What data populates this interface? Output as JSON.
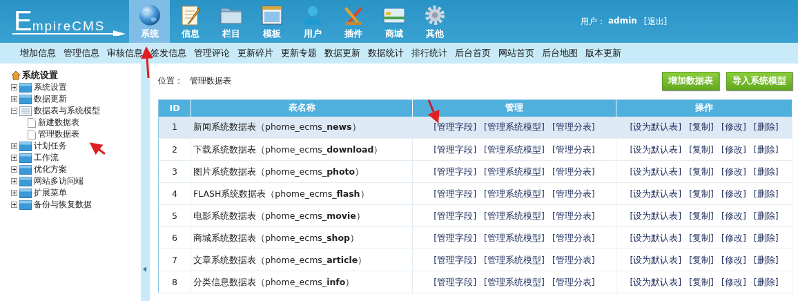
{
  "logo": {
    "text": "EmpireCMS"
  },
  "nav": [
    {
      "label": "系统",
      "kind": "globe",
      "selected": true
    },
    {
      "label": "信息",
      "kind": "notepad",
      "selected": false
    },
    {
      "label": "栏目",
      "kind": "folder",
      "selected": false
    },
    {
      "label": "模板",
      "kind": "window",
      "selected": false
    },
    {
      "label": "用户",
      "kind": "person",
      "selected": false
    },
    {
      "label": "插件",
      "kind": "tools",
      "selected": false
    },
    {
      "label": "商城",
      "kind": "card",
      "selected": false
    },
    {
      "label": "其他",
      "kind": "gear",
      "selected": false
    }
  ],
  "user": {
    "label": "用户：",
    "name": "admin",
    "logout": "[退出]"
  },
  "subnav": [
    "增加信息",
    "管理信息",
    "审核信息",
    "签发信息",
    "管理评论",
    "更新碎片",
    "更新专题",
    "数据更新",
    "数据统计",
    "排行统计",
    "后台首页",
    "网站首页",
    "后台地图",
    "版本更新"
  ],
  "sidebar": {
    "title": "系统设置",
    "items": [
      {
        "label": "系统设置",
        "expanded": false
      },
      {
        "label": "数据更新",
        "expanded": false
      },
      {
        "label": "数据表与系统模型",
        "expanded": true,
        "children": [
          {
            "label": "新建数据表"
          },
          {
            "label": "管理数据表"
          }
        ]
      },
      {
        "label": "计划任务",
        "expanded": false
      },
      {
        "label": "工作流",
        "expanded": false
      },
      {
        "label": "优化方案",
        "expanded": false
      },
      {
        "label": "网站多访问端",
        "expanded": false
      },
      {
        "label": "扩展菜单",
        "expanded": false
      },
      {
        "label": "备份与恢复数据",
        "expanded": false
      }
    ]
  },
  "location": {
    "label": "位置：",
    "value": "管理数据表"
  },
  "buttons": [
    "增加数据表",
    "导入系统模型"
  ],
  "table": {
    "columns": [
      "ID",
      "表名称",
      "管理",
      "操作"
    ],
    "rows": [
      {
        "id": "1",
        "name": "新闻系统数据表（phome_ecms_**news**）",
        "selected": true,
        "manage": [
          "[管理字段]",
          "[管理系统模型]",
          "[管理分表]"
        ],
        "actions": [
          "[设为默认表]",
          "[复制]",
          "[修改]",
          "[删除]"
        ]
      },
      {
        "id": "2",
        "name": "下载系统数据表（phome_ecms_**download**）",
        "selected": false,
        "manage": [
          "[管理字段]",
          "[管理系统模型]",
          "[管理分表]"
        ],
        "actions": [
          "[设为默认表]",
          "[复制]",
          "[修改]",
          "[删除]"
        ]
      },
      {
        "id": "3",
        "name": "图片系统数据表（phome_ecms_**photo**）",
        "selected": false,
        "manage": [
          "[管理字段]",
          "[管理系统模型]",
          "[管理分表]"
        ],
        "actions": [
          "[设为默认表]",
          "[复制]",
          "[修改]",
          "[删除]"
        ]
      },
      {
        "id": "4",
        "name": "FLASH系统数据表（phome_ecms_**flash**）",
        "selected": false,
        "manage": [
          "[管理字段]",
          "[管理系统模型]",
          "[管理分表]"
        ],
        "actions": [
          "[设为默认表]",
          "[复制]",
          "[修改]",
          "[删除]"
        ]
      },
      {
        "id": "5",
        "name": "电影系统数据表（phome_ecms_**movie**）",
        "selected": false,
        "manage": [
          "[管理字段]",
          "[管理系统模型]",
          "[管理分表]"
        ],
        "actions": [
          "[设为默认表]",
          "[复制]",
          "[修改]",
          "[删除]"
        ]
      },
      {
        "id": "6",
        "name": "商城系统数据表（phome_ecms_**shop**）",
        "selected": false,
        "manage": [
          "[管理字段]",
          "[管理系统模型]",
          "[管理分表]"
        ],
        "actions": [
          "[设为默认表]",
          "[复制]",
          "[修改]",
          "[删除]"
        ]
      },
      {
        "id": "7",
        "name": "文章系统数据表（phome_ecms_**article**）",
        "selected": false,
        "manage": [
          "[管理字段]",
          "[管理系统模型]",
          "[管理分表]"
        ],
        "actions": [
          "[设为默认表]",
          "[复制]",
          "[修改]",
          "[删除]"
        ]
      },
      {
        "id": "8",
        "name": "分类信息数据表（phome_ecms_**info**）",
        "selected": false,
        "manage": [
          "[管理字段]",
          "[管理系统模型]",
          "[管理分表]"
        ],
        "actions": [
          "[设为默认表]",
          "[复制]",
          "[修改]",
          "[删除]"
        ]
      }
    ]
  }
}
